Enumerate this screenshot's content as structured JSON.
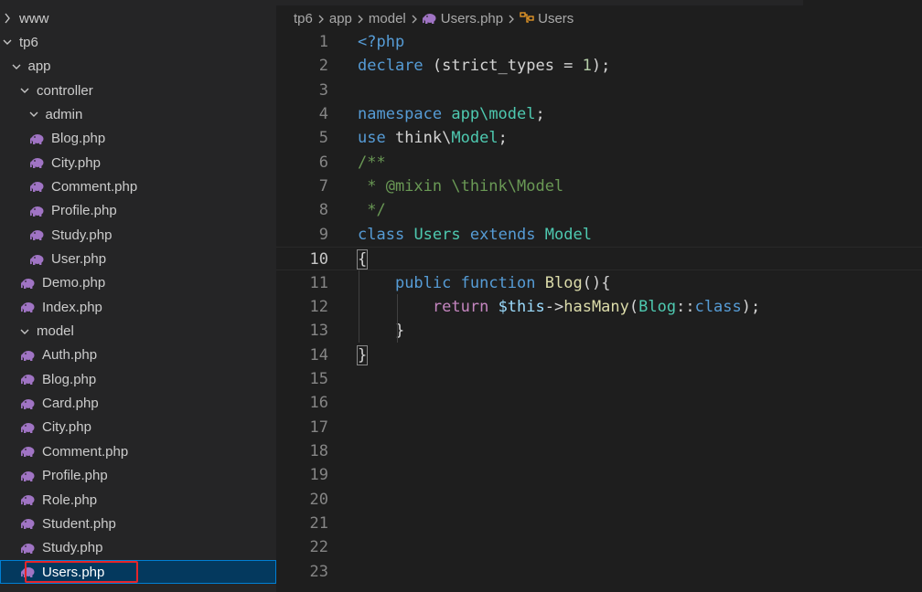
{
  "sidebar": {
    "items": [
      {
        "label": "www",
        "type": "folder",
        "expanded": false,
        "depth": 0
      },
      {
        "label": "tp6",
        "type": "folder",
        "expanded": true,
        "depth": 0
      },
      {
        "label": "app",
        "type": "folder",
        "expanded": true,
        "depth": 1
      },
      {
        "label": "controller",
        "type": "folder",
        "expanded": true,
        "depth": 2
      },
      {
        "label": "admin",
        "type": "folder",
        "expanded": true,
        "depth": 3
      },
      {
        "label": "Blog.php",
        "type": "file",
        "depth": 4
      },
      {
        "label": "City.php",
        "type": "file",
        "depth": 4
      },
      {
        "label": "Comment.php",
        "type": "file",
        "depth": 4
      },
      {
        "label": "Profile.php",
        "type": "file",
        "depth": 4
      },
      {
        "label": "Study.php",
        "type": "file",
        "depth": 4
      },
      {
        "label": "User.php",
        "type": "file",
        "depth": 4
      },
      {
        "label": "Demo.php",
        "type": "file",
        "depth": 3
      },
      {
        "label": "Index.php",
        "type": "file",
        "depth": 3
      },
      {
        "label": "model",
        "type": "folder",
        "expanded": true,
        "depth": 2
      },
      {
        "label": "Auth.php",
        "type": "file",
        "depth": 3
      },
      {
        "label": "Blog.php",
        "type": "file",
        "depth": 3
      },
      {
        "label": "Card.php",
        "type": "file",
        "depth": 3
      },
      {
        "label": "City.php",
        "type": "file",
        "depth": 3
      },
      {
        "label": "Comment.php",
        "type": "file",
        "depth": 3
      },
      {
        "label": "Profile.php",
        "type": "file",
        "depth": 3
      },
      {
        "label": "Role.php",
        "type": "file",
        "depth": 3
      },
      {
        "label": "Student.php",
        "type": "file",
        "depth": 3
      },
      {
        "label": "Study.php",
        "type": "file",
        "depth": 3
      },
      {
        "label": "Users.php",
        "type": "file",
        "depth": 3,
        "selected": true
      }
    ]
  },
  "breadcrumb": {
    "parts": [
      "tp6",
      "app",
      "model",
      "Users.php",
      "Users"
    ]
  },
  "editor": {
    "current_line": 10,
    "lines": [
      {
        "n": "1",
        "tokens": [
          [
            "tag",
            "<?php"
          ]
        ]
      },
      {
        "n": "2",
        "tokens": [
          [
            "kw",
            "declare"
          ],
          [
            "plain",
            " (strict_types = "
          ],
          [
            "num",
            "1"
          ],
          [
            "plain",
            ");"
          ]
        ]
      },
      {
        "n": "3",
        "tokens": []
      },
      {
        "n": "4",
        "tokens": [
          [
            "kw",
            "namespace"
          ],
          [
            "plain",
            " "
          ],
          [
            "cls",
            "app\\model"
          ],
          [
            "plain",
            ";"
          ]
        ]
      },
      {
        "n": "5",
        "tokens": [
          [
            "kw",
            "use"
          ],
          [
            "plain",
            " think\\"
          ],
          [
            "cls",
            "Model"
          ],
          [
            "plain",
            ";"
          ]
        ]
      },
      {
        "n": "6",
        "tokens": [
          [
            "cmt",
            "/**"
          ]
        ]
      },
      {
        "n": "7",
        "tokens": [
          [
            "cmt",
            " * @mixin \\think\\Model"
          ]
        ]
      },
      {
        "n": "8",
        "tokens": [
          [
            "cmt",
            " */"
          ]
        ]
      },
      {
        "n": "9",
        "tokens": [
          [
            "kw",
            "class"
          ],
          [
            "plain",
            " "
          ],
          [
            "cls",
            "Users"
          ],
          [
            "plain",
            " "
          ],
          [
            "kw",
            "extends"
          ],
          [
            "plain",
            " "
          ],
          [
            "cls",
            "Model"
          ]
        ]
      },
      {
        "n": "10",
        "tokens": [
          [
            "bracket",
            "{"
          ]
        ]
      },
      {
        "n": "11",
        "tokens": [
          [
            "plain",
            "    "
          ],
          [
            "kw",
            "public"
          ],
          [
            "plain",
            " "
          ],
          [
            "kw",
            "function"
          ],
          [
            "plain",
            " "
          ],
          [
            "fn",
            "Blog"
          ],
          [
            "plain",
            "(){"
          ]
        ]
      },
      {
        "n": "12",
        "tokens": [
          [
            "plain",
            "        "
          ],
          [
            "ctl",
            "return"
          ],
          [
            "plain",
            " "
          ],
          [
            "var",
            "$this"
          ],
          [
            "plain",
            "->"
          ],
          [
            "fn",
            "hasMany"
          ],
          [
            "plain",
            "("
          ],
          [
            "cls",
            "Blog"
          ],
          [
            "plain",
            "::"
          ],
          [
            "kw",
            "class"
          ],
          [
            "plain",
            ");"
          ]
        ]
      },
      {
        "n": "13",
        "tokens": [
          [
            "plain",
            "    }"
          ]
        ]
      },
      {
        "n": "14",
        "tokens": [
          [
            "bracket",
            "}"
          ]
        ]
      },
      {
        "n": "15",
        "tokens": []
      },
      {
        "n": "16",
        "tokens": []
      },
      {
        "n": "17",
        "tokens": []
      },
      {
        "n": "18",
        "tokens": []
      },
      {
        "n": "19",
        "tokens": []
      },
      {
        "n": "20",
        "tokens": []
      },
      {
        "n": "21",
        "tokens": []
      },
      {
        "n": "22",
        "tokens": []
      },
      {
        "n": "23",
        "tokens": []
      }
    ]
  },
  "colors": {
    "keyword": "#569cd6",
    "control": "#c586c0",
    "function": "#dcdcaa",
    "class": "#4ec9b0",
    "number": "#b5cea8",
    "variable": "#9cdcfe",
    "comment": "#6a9955",
    "php_icon": "#a074c4",
    "highlight_box": "#e5252a"
  },
  "icons": {
    "file": "php-elephant-icon",
    "folder_collapsed": "chevron-right-icon",
    "folder_expanded": "chevron-down-icon",
    "symbol": "class-symbol-icon"
  }
}
